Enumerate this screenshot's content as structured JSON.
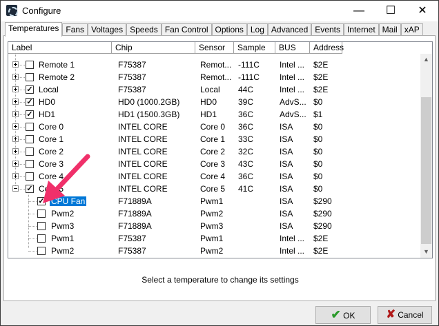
{
  "window": {
    "title": "Configure",
    "minimize": "—",
    "maximize": "☐",
    "close": "✕"
  },
  "tabs": [
    {
      "label": "Temperatures",
      "active": true
    },
    {
      "label": "Fans"
    },
    {
      "label": "Voltages"
    },
    {
      "label": "Speeds"
    },
    {
      "label": "Fan Control"
    },
    {
      "label": "Options"
    },
    {
      "label": "Log"
    },
    {
      "label": "Advanced"
    },
    {
      "label": "Events"
    },
    {
      "label": "Internet"
    },
    {
      "label": "Mail"
    },
    {
      "label": "xAP"
    }
  ],
  "columns": [
    "Label",
    "Chip",
    "Sensor",
    "Sample",
    "BUS",
    "Address"
  ],
  "rows": [
    {
      "label": "Remote 1",
      "chip": "F75387",
      "sensor": "Remot...",
      "sample": "-111C",
      "bus": "Intel ...",
      "address": "$2E",
      "checked": false,
      "expander": "plus"
    },
    {
      "label": "Remote 2",
      "chip": "F75387",
      "sensor": "Remot...",
      "sample": "-111C",
      "bus": "Intel ...",
      "address": "$2E",
      "checked": false,
      "expander": "plus"
    },
    {
      "label": "Local",
      "chip": "F75387",
      "sensor": "Local",
      "sample": "44C",
      "bus": "Intel ...",
      "address": "$2E",
      "checked": true,
      "expander": "plus"
    },
    {
      "label": "HD0",
      "chip": "HD0 (1000.2GB)",
      "sensor": "HD0",
      "sample": "39C",
      "bus": "AdvS...",
      "address": "$0",
      "checked": true,
      "expander": "plus"
    },
    {
      "label": "HD1",
      "chip": "HD1 (1500.3GB)",
      "sensor": "HD1",
      "sample": "36C",
      "bus": "AdvS...",
      "address": "$1",
      "checked": true,
      "expander": "plus"
    },
    {
      "label": "Core 0",
      "chip": "INTEL CORE",
      "sensor": "Core 0",
      "sample": "36C",
      "bus": "ISA",
      "address": "$0",
      "checked": false,
      "expander": "plus"
    },
    {
      "label": "Core 1",
      "chip": "INTEL CORE",
      "sensor": "Core 1",
      "sample": "33C",
      "bus": "ISA",
      "address": "$0",
      "checked": false,
      "expander": "plus"
    },
    {
      "label": "Core 2",
      "chip": "INTEL CORE",
      "sensor": "Core 2",
      "sample": "32C",
      "bus": "ISA",
      "address": "$0",
      "checked": false,
      "expander": "plus"
    },
    {
      "label": "Core 3",
      "chip": "INTEL CORE",
      "sensor": "Core 3",
      "sample": "43C",
      "bus": "ISA",
      "address": "$0",
      "checked": false,
      "expander": "plus"
    },
    {
      "label": "Core 4",
      "chip": "INTEL CORE",
      "sensor": "Core 4",
      "sample": "36C",
      "bus": "ISA",
      "address": "$0",
      "checked": false,
      "expander": "plus"
    },
    {
      "label": "Core 5",
      "chip": "INTEL CORE",
      "sensor": "Core 5",
      "sample": "41C",
      "bus": "ISA",
      "address": "$0",
      "checked": true,
      "expander": "minus"
    },
    {
      "label": "CPU Fan",
      "chip": "F71889A",
      "sensor": "Pwm1",
      "sample": "",
      "bus": "ISA",
      "address": "$290",
      "checked": true,
      "child": true,
      "selected": true
    },
    {
      "label": "Pwm2",
      "chip": "F71889A",
      "sensor": "Pwm2",
      "sample": "",
      "bus": "ISA",
      "address": "$290",
      "checked": false,
      "child": true
    },
    {
      "label": "Pwm3",
      "chip": "F71889A",
      "sensor": "Pwm3",
      "sample": "",
      "bus": "ISA",
      "address": "$290",
      "checked": false,
      "child": true
    },
    {
      "label": "Pwm1",
      "chip": "F75387",
      "sensor": "Pwm1",
      "sample": "",
      "bus": "Intel ...",
      "address": "$2E",
      "checked": false,
      "child": true
    },
    {
      "label": "Pwm2",
      "chip": "F75387",
      "sensor": "Pwm2",
      "sample": "",
      "bus": "Intel ...",
      "address": "$2E",
      "checked": false,
      "child": true
    }
  ],
  "status": "Select a temperature to change its settings",
  "buttons": {
    "ok": "OK",
    "cancel": "Cancel"
  },
  "colors": {
    "selection": "#0078d7",
    "annotation_arrow": "#f0306a",
    "ok_check": "#2a9a2a",
    "cancel_x": "#b01818"
  }
}
